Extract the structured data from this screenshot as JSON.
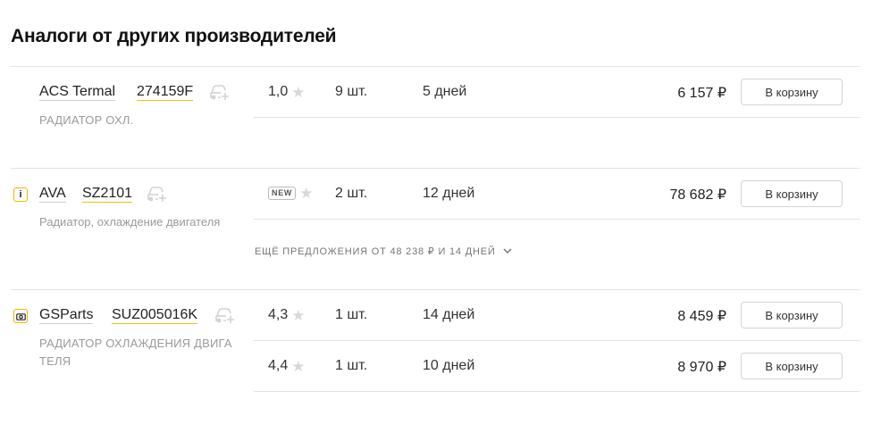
{
  "title": "Аналоги от других производителей",
  "star_glyph": "★",
  "offers": [
    {
      "brand": "ACS Termal",
      "article": "274159F",
      "description": "РАДИАТОР ОХЛ.",
      "rows": [
        {
          "rating": "1,0",
          "qty": "9 шт.",
          "days": "5 дней",
          "price": "6 157 ₽",
          "cart_label": "В корзину"
        }
      ]
    },
    {
      "brand": "AVA",
      "article": "SZ2101",
      "description": "Радиатор, охлаждение двигателя",
      "info_icon": "i",
      "rows": [
        {
          "badge": "NEW",
          "qty": "2 шт.",
          "days": "12 дней",
          "price": "78 682 ₽",
          "cart_label": "В корзину"
        }
      ],
      "more_offers": "ЕЩЁ ПРЕДЛОЖЕНИЯ ОТ 48 238 ₽ И 14 ДНЕЙ"
    },
    {
      "brand": "GSParts",
      "article": "SUZ005016K",
      "description_line1": "РАДИАТОР ОХЛАЖДЕНИЯ ДВИГА",
      "description_line2": "ТЕЛЯ",
      "rows": [
        {
          "rating": "4,3",
          "qty": "1 шт.",
          "days": "14 дней",
          "price": "8 459 ₽",
          "cart_label": "В корзину"
        },
        {
          "rating": "4,4",
          "qty": "1 шт.",
          "days": "10 дней",
          "price": "8 970 ₽",
          "cart_label": "В корзину"
        }
      ]
    }
  ]
}
